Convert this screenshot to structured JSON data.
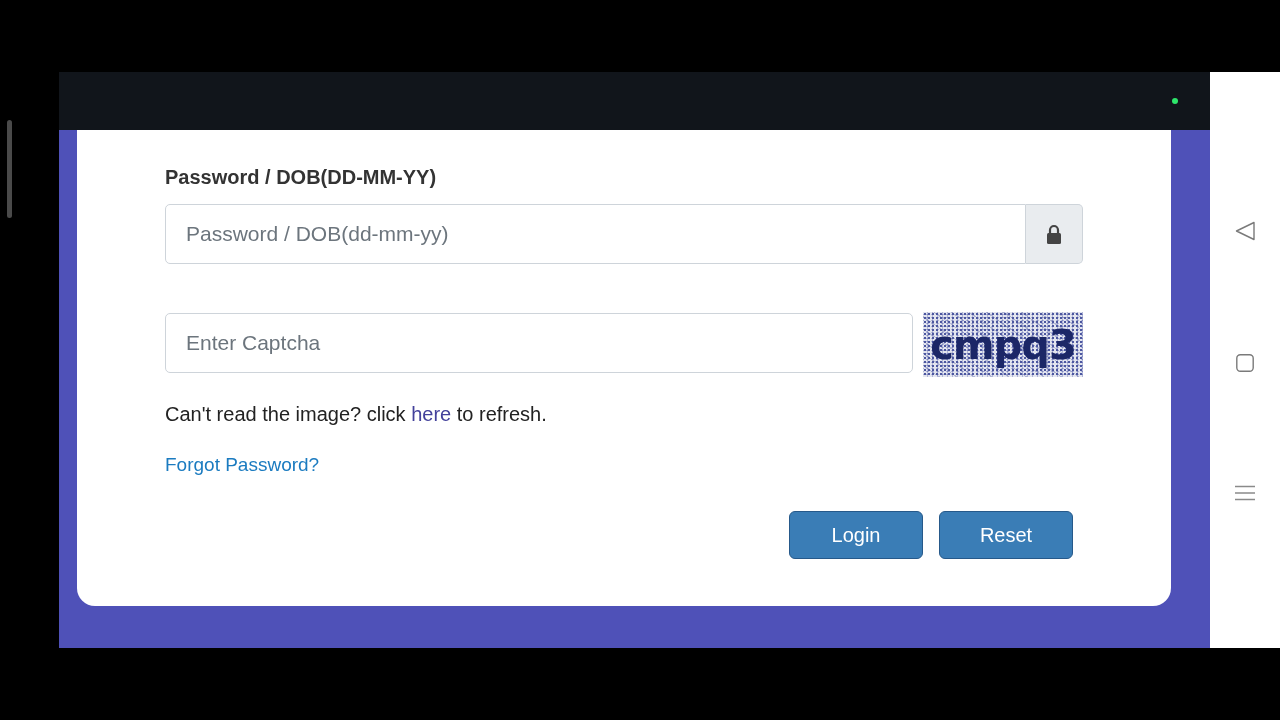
{
  "form": {
    "password_label": "Password / DOB(DD-MM-YY)",
    "password_field": {
      "placeholder": "Password / DOB(dd-mm-yy)"
    },
    "captcha_field": {
      "placeholder": "Enter Captcha"
    },
    "captcha_image": {
      "text": "cmpq3"
    },
    "refresh_hint": {
      "text_before": "Can't read the image? click ",
      "link": "here",
      "text_after": " to refresh."
    },
    "forgot_password_link": "Forgot Password?",
    "buttons": [
      "Login",
      "Reset"
    ]
  }
}
